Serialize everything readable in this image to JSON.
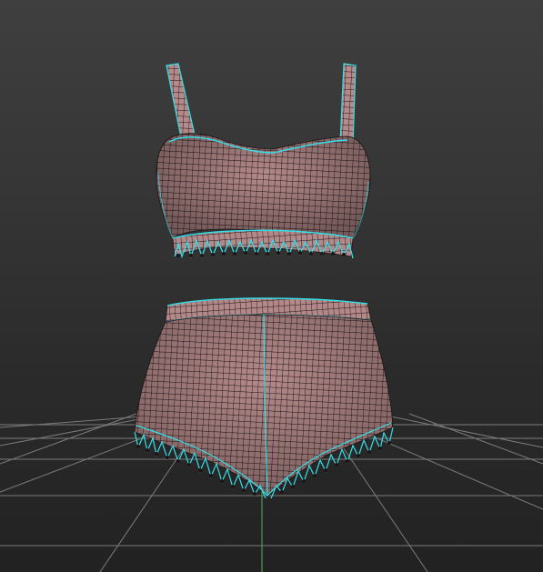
{
  "viewport": {
    "colors": {
      "background_top": "#3f3f3f",
      "background_bottom": "#222222",
      "grid": "#8a8a8a",
      "grid_axis": "#4c9a4c",
      "garment_fill": "#b58a8a",
      "garment_fill_dark": "#7d5858",
      "mesh_line": "#1e1416",
      "seam": "#33e0e8"
    },
    "objects": [
      {
        "name": "bra-top",
        "icon": "garment-mesh"
      },
      {
        "name": "shorts-bottom",
        "icon": "garment-mesh"
      }
    ],
    "grid": {
      "visible": true
    }
  }
}
